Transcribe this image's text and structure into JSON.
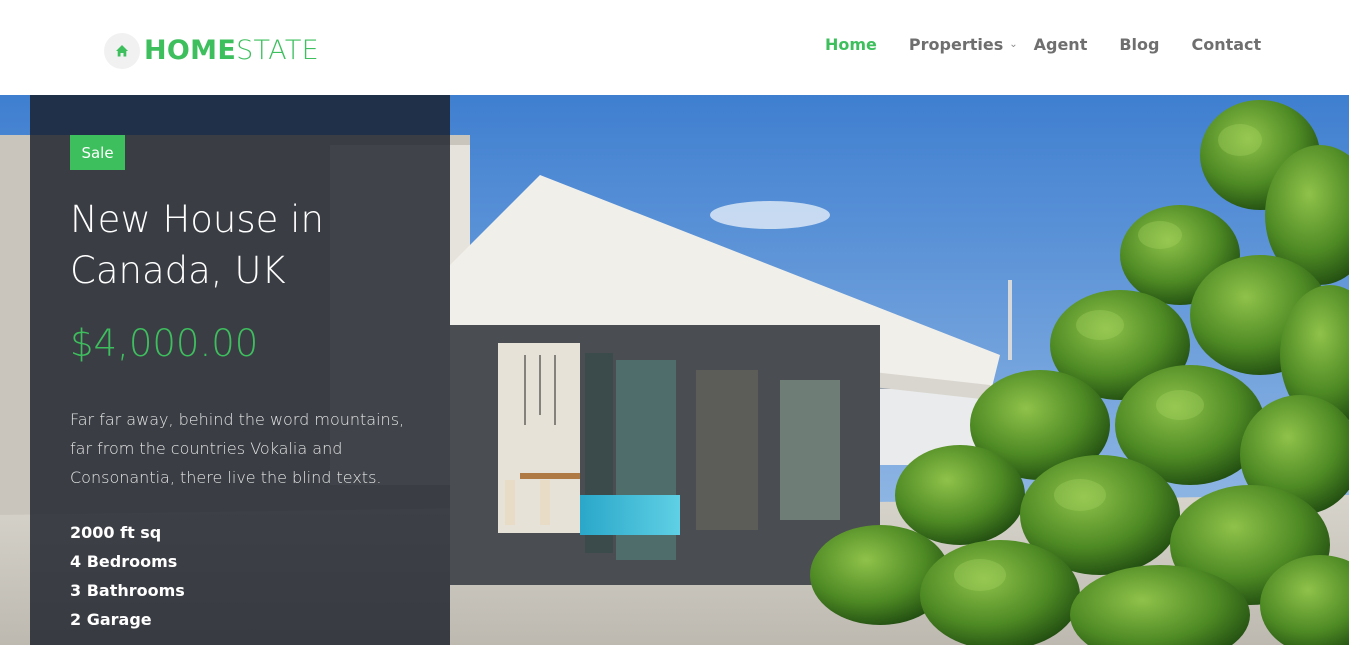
{
  "brand": {
    "name_strong": "HOME",
    "name_light": "STATE",
    "accent_color": "#3ebf5e",
    "icon": "home-icon"
  },
  "nav": {
    "items": [
      {
        "label": "Home",
        "active": true
      },
      {
        "label": "Properties",
        "has_dropdown": true
      },
      {
        "label": "Agent"
      },
      {
        "label": "Blog"
      },
      {
        "label": "Contact"
      }
    ]
  },
  "listing": {
    "badge": "Sale",
    "title": "New House in Canada, UK",
    "price": "$4,000.00",
    "description": "Far far away, behind the word mountains, far from the countries Vokalia and Consonantia, there live the blind texts.",
    "features": [
      "2000 ft sq",
      "4 Bedrooms",
      "3 Bathrooms",
      "2 Garage"
    ]
  }
}
